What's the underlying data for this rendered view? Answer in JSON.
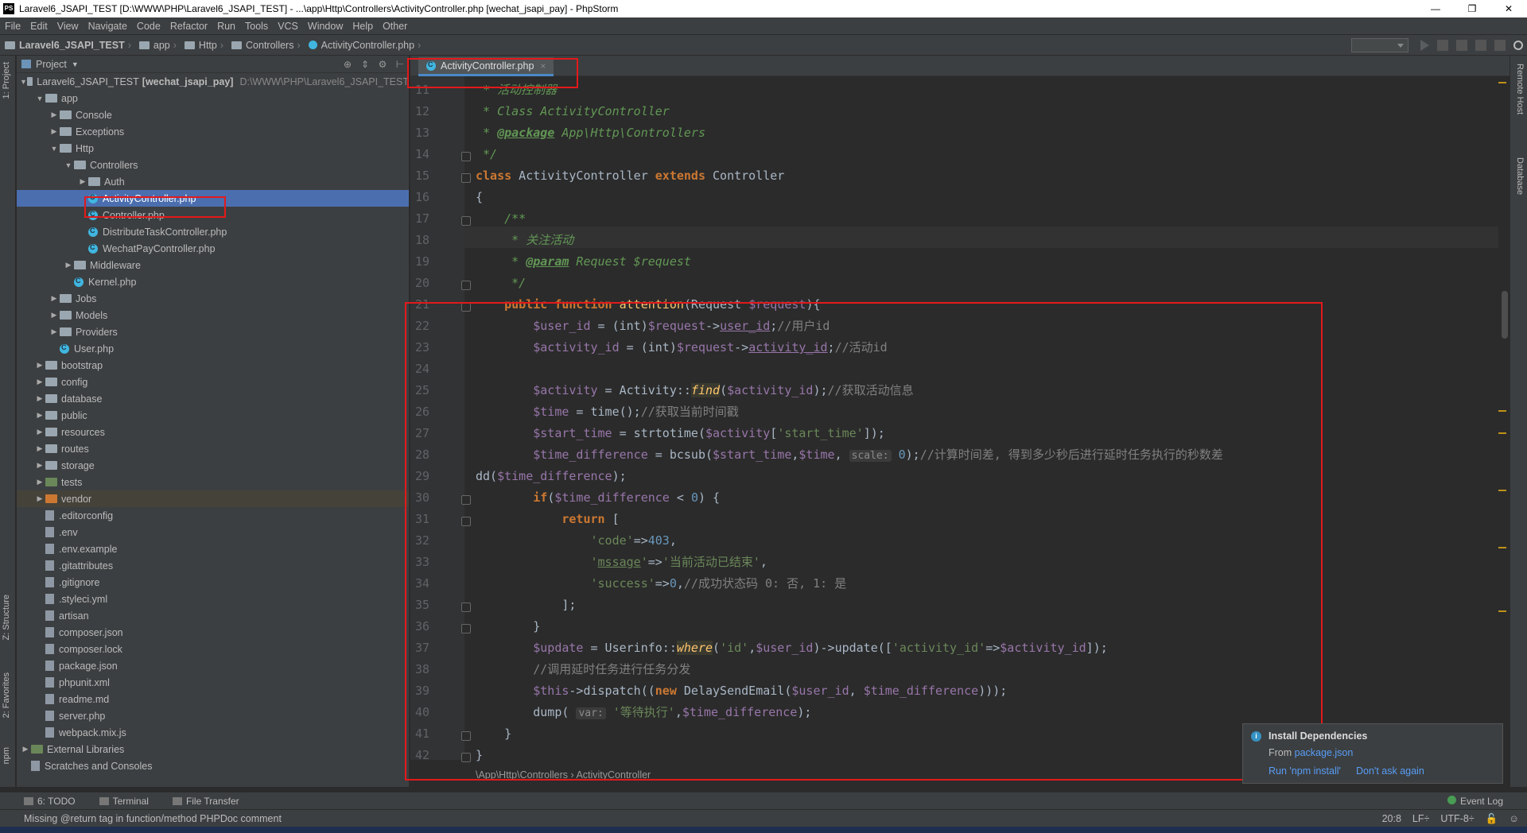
{
  "window": {
    "title": "Laravel6_JSAPI_TEST [D:\\WWW\\PHP\\Laravel6_JSAPI_TEST] - ...\\app\\Http\\Controllers\\ActivityController.php [wechat_jsapi_pay] - PhpStorm",
    "logo": "PS",
    "minimize": "—",
    "restore": "❐",
    "close": "✕"
  },
  "menu": [
    "File",
    "Edit",
    "View",
    "Navigate",
    "Code",
    "Refactor",
    "Run",
    "Tools",
    "VCS",
    "Window",
    "Help",
    "Other"
  ],
  "breadcrumb": [
    "Laravel6_JSAPI_TEST",
    "app",
    "Http",
    "Controllers",
    "ActivityController.php"
  ],
  "leftstrip": {
    "project": "1: Project",
    "structure": "Z: Structure",
    "favorites": "2: Favorites",
    "npm": "npm"
  },
  "rightstrip": {
    "remote": "Remote Host",
    "database": "Database"
  },
  "project": {
    "title": "Project",
    "tree": [
      {
        "label": "Laravel6_JSAPI_TEST",
        "bold": "[wechat_jsapi_pay]",
        "path": "D:\\WWW\\PHP\\Laravel6_JSAPI_TEST",
        "indent": 0,
        "arrow": "▼",
        "icon": "folder"
      },
      {
        "label": "app",
        "indent": 1,
        "arrow": "▼",
        "icon": "folder"
      },
      {
        "label": "Console",
        "indent": 2,
        "arrow": "▶",
        "icon": "folder"
      },
      {
        "label": "Exceptions",
        "indent": 2,
        "arrow": "▶",
        "icon": "folder"
      },
      {
        "label": "Http",
        "indent": 2,
        "arrow": "▼",
        "icon": "folder"
      },
      {
        "label": "Controllers",
        "indent": 3,
        "arrow": "▼",
        "icon": "folder"
      },
      {
        "label": "Auth",
        "indent": 4,
        "arrow": "▶",
        "icon": "folder"
      },
      {
        "label": "ActivityController.php",
        "indent": 4,
        "arrow": "",
        "icon": "class",
        "selected": true
      },
      {
        "label": "Controller.php",
        "indent": 4,
        "arrow": "",
        "icon": "class"
      },
      {
        "label": "DistributeTaskController.php",
        "indent": 4,
        "arrow": "",
        "icon": "class"
      },
      {
        "label": "WechatPayController.php",
        "indent": 4,
        "arrow": "",
        "icon": "class"
      },
      {
        "label": "Middleware",
        "indent": 3,
        "arrow": "▶",
        "icon": "folder"
      },
      {
        "label": "Kernel.php",
        "indent": 3,
        "arrow": "",
        "icon": "class"
      },
      {
        "label": "Jobs",
        "indent": 2,
        "arrow": "▶",
        "icon": "folder"
      },
      {
        "label": "Models",
        "indent": 2,
        "arrow": "▶",
        "icon": "folder"
      },
      {
        "label": "Providers",
        "indent": 2,
        "arrow": "▶",
        "icon": "folder"
      },
      {
        "label": "User.php",
        "indent": 2,
        "arrow": "",
        "icon": "class"
      },
      {
        "label": "bootstrap",
        "indent": 1,
        "arrow": "▶",
        "icon": "folder"
      },
      {
        "label": "config",
        "indent": 1,
        "arrow": "▶",
        "icon": "folder"
      },
      {
        "label": "database",
        "indent": 1,
        "arrow": "▶",
        "icon": "folder"
      },
      {
        "label": "public",
        "indent": 1,
        "arrow": "▶",
        "icon": "folder"
      },
      {
        "label": "resources",
        "indent": 1,
        "arrow": "▶",
        "icon": "folder"
      },
      {
        "label": "routes",
        "indent": 1,
        "arrow": "▶",
        "icon": "folder"
      },
      {
        "label": "storage",
        "indent": 1,
        "arrow": "▶",
        "icon": "folder"
      },
      {
        "label": "tests",
        "indent": 1,
        "arrow": "▶",
        "icon": "folder-green"
      },
      {
        "label": "vendor",
        "indent": 1,
        "arrow": "▶",
        "icon": "folder-orange",
        "vendor": true
      },
      {
        "label": ".editorconfig",
        "indent": 1,
        "arrow": "",
        "icon": "file"
      },
      {
        "label": ".env",
        "indent": 1,
        "arrow": "",
        "icon": "file"
      },
      {
        "label": ".env.example",
        "indent": 1,
        "arrow": "",
        "icon": "file"
      },
      {
        "label": ".gitattributes",
        "indent": 1,
        "arrow": "",
        "icon": "file"
      },
      {
        "label": ".gitignore",
        "indent": 1,
        "arrow": "",
        "icon": "file"
      },
      {
        "label": ".styleci.yml",
        "indent": 1,
        "arrow": "",
        "icon": "file"
      },
      {
        "label": "artisan",
        "indent": 1,
        "arrow": "",
        "icon": "file"
      },
      {
        "label": "composer.json",
        "indent": 1,
        "arrow": "",
        "icon": "file"
      },
      {
        "label": "composer.lock",
        "indent": 1,
        "arrow": "",
        "icon": "file"
      },
      {
        "label": "package.json",
        "indent": 1,
        "arrow": "",
        "icon": "file"
      },
      {
        "label": "phpunit.xml",
        "indent": 1,
        "arrow": "",
        "icon": "file"
      },
      {
        "label": "readme.md",
        "indent": 1,
        "arrow": "",
        "icon": "file"
      },
      {
        "label": "server.php",
        "indent": 1,
        "arrow": "",
        "icon": "file"
      },
      {
        "label": "webpack.mix.js",
        "indent": 1,
        "arrow": "",
        "icon": "file"
      },
      {
        "label": "External Libraries",
        "indent": 0,
        "arrow": "▶",
        "icon": "library"
      },
      {
        "label": "Scratches and Consoles",
        "indent": 0,
        "arrow": "",
        "icon": "scratch"
      }
    ]
  },
  "editor": {
    "tab": "ActivityController.php",
    "tab_close": "×",
    "breadcrumb": "\\App\\Http\\Controllers  ›  ActivityController",
    "lines": [
      {
        "n": "11",
        "html": "<span class=\"cm\"> * 活动控制器</span>"
      },
      {
        "n": "12",
        "html": "<span class=\"cm\"> * Class ActivityController</span>"
      },
      {
        "n": "13",
        "html": "<span class=\"cm\"> * <span class=\"tagc\">@package</span> App\\Http\\Controllers</span>"
      },
      {
        "n": "14",
        "html": "<span class=\"cm\"> */</span>"
      },
      {
        "n": "15",
        "html": "<span class=\"kw\">class</span> ActivityController <span class=\"kw\">extends</span> Controller"
      },
      {
        "n": "16",
        "html": "{"
      },
      {
        "n": "17",
        "html": "    <span class=\"cm\">/**</span>"
      },
      {
        "n": "18",
        "html": "<span class=\"cm\">     * 关注活动</span>"
      },
      {
        "n": "19",
        "html": "<span class=\"cm\">     * <span class=\"tagc\">@param</span> Request $request</span>"
      },
      {
        "n": "20",
        "html": "<span class=\"cm\">     */</span>"
      },
      {
        "n": "21",
        "html": "    <span class=\"kw\">public function</span> <span class=\"fn\">attention</span>(Request <span class=\"vr\">$request</span>){"
      },
      {
        "n": "22",
        "html": "        <span class=\"vr\">$user_id</span> = (<span class=\"kw\" style=\"font-weight:normal;color:#a9b7c6\">int</span>)<span class=\"vr\">$request</span>-><span class=\"vr\" style=\"text-decoration:underline\">user_id</span>;<span class=\"cmt\">//用户id</span>"
      },
      {
        "n": "23",
        "html": "        <span class=\"vr\">$activity_id</span> = (int)<span class=\"vr\">$request</span>-><span class=\"vr\" style=\"text-decoration:underline\">activity_id</span>;<span class=\"cmt\">//活动id</span>"
      },
      {
        "n": "24",
        "html": ""
      },
      {
        "n": "25",
        "html": "        <span class=\"vr\">$activity</span> = Activity::<span class=\"sf\">find</span>(<span class=\"vr\">$activity_id</span>);<span class=\"cmt\">//获取活动信息</span>"
      },
      {
        "n": "26",
        "html": "        <span class=\"vr\">$time</span> = time();<span class=\"cmt\">//获取当前时间戳</span>"
      },
      {
        "n": "27",
        "html": "        <span class=\"vr\">$start_time</span> = strtotime(<span class=\"vr\">$activity</span>[<span class=\"st\">'start_time'</span>]);"
      },
      {
        "n": "28",
        "html": "        <span class=\"vr\">$time_difference</span> = bcsub(<span class=\"vr\">$start_time</span>,<span class=\"vr\">$time</span>, <span class=\"hint\">scale:</span> <span class=\"nm\">0</span>);<span class=\"cmt\">//计算时间差, 得到多少秒后进行延时任务执行的秒数差</span>"
      },
      {
        "n": "29",
        "html": "dd(<span class=\"vr\">$time_difference</span>);"
      },
      {
        "n": "30",
        "html": "        <span class=\"kw\">if</span>(<span class=\"vr\">$time_difference</span> &lt; <span class=\"nm\">0</span>) {"
      },
      {
        "n": "31",
        "html": "            <span class=\"kw\">return</span> ["
      },
      {
        "n": "32",
        "html": "                <span class=\"st\">'code'</span>=><span class=\"nm\">403</span>,"
      },
      {
        "n": "33",
        "html": "                <span class=\"st\">'<u>mssage</u>'</span>=><span class=\"st\">'当前活动已结束'</span>,"
      },
      {
        "n": "34",
        "html": "                <span class=\"st\">'success'</span>=><span class=\"nm\">0</span>,<span class=\"cmt\">//成功状态码 0: 否, 1: 是</span>"
      },
      {
        "n": "35",
        "html": "            ];"
      },
      {
        "n": "36",
        "html": "        }"
      },
      {
        "n": "37",
        "html": "        <span class=\"vr\">$update</span> = Userinfo::<span class=\"sf\">where</span>(<span class=\"st\">'id'</span>,<span class=\"vr\">$user_id</span>)-><span class=\"fn\" style=\"color:#a9b7c6\">update</span>([<span class=\"st\">'activity_id'</span>=><span class=\"vr\">$activity_id</span>]);"
      },
      {
        "n": "38",
        "html": "        <span class=\"cmt\">//调用延时任务进行任务分发</span>"
      },
      {
        "n": "39",
        "html": "        <span class=\"vr\">$this</span>->dispatch((<span class=\"kw\">new</span> DelaySendEmail(<span class=\"vr\">$user_id</span>, <span class=\"vr\">$time_difference</span>)));"
      },
      {
        "n": "40",
        "html": "        dump( <span class=\"hint\">var:</span> <span class=\"st\">'等待执行'</span>,<span class=\"vr\">$time_difference</span>);"
      },
      {
        "n": "41",
        "html": "    }"
      },
      {
        "n": "42",
        "html": "}"
      }
    ]
  },
  "notification": {
    "title": "Install Dependencies",
    "from_prefix": "From ",
    "from_link": "package.json",
    "action1": "Run 'npm install'",
    "action2": "Don't ask again",
    "icon": "i"
  },
  "bottom": {
    "todo": "6: TODO",
    "terminal": "Terminal",
    "filetransfer": "File Transfer",
    "eventlog": "Event Log"
  },
  "status": {
    "message": "Missing @return tag in function/method PHPDoc comment",
    "position": "20:8",
    "lf": "LF÷",
    "encoding": "UTF-8÷"
  },
  "colors": {
    "accent": "#4b6eaf",
    "redbox": "#e3191b",
    "background": "#2b2b2b",
    "panel": "#3c3f41"
  }
}
